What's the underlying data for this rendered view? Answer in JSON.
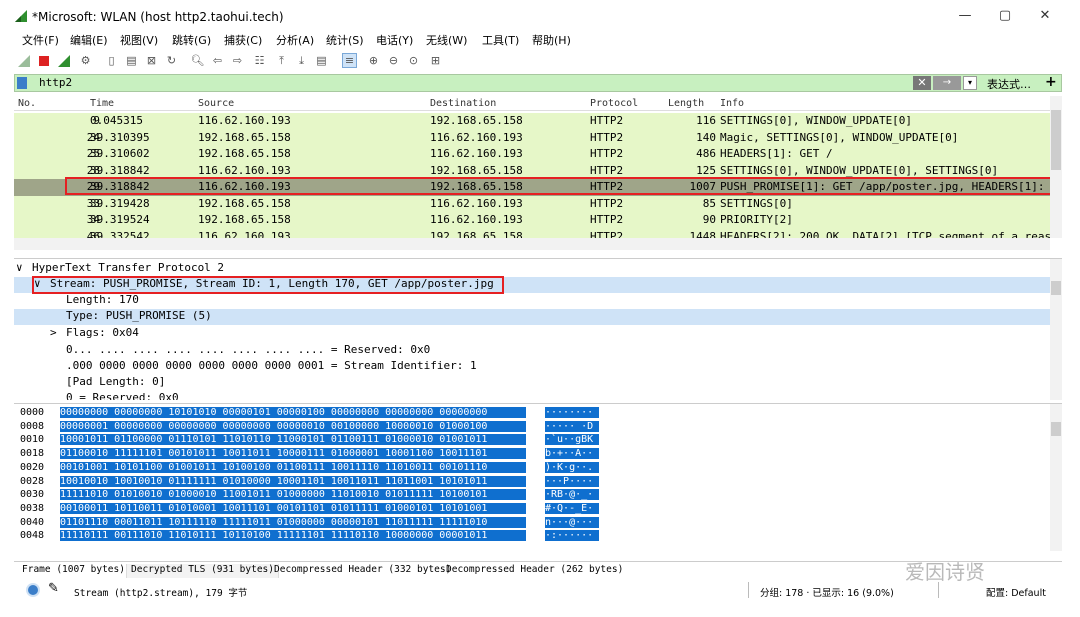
{
  "window": {
    "title": "*Microsoft: WLAN (host http2.taohui.tech)",
    "minimize": "—",
    "restore": "▢",
    "close": "✕"
  },
  "menu": [
    "文件(F)",
    "编辑(E)",
    "视图(V)",
    "跳转(G)",
    "捕获(C)",
    "分析(A)",
    "统计(S)",
    "电话(Y)",
    "无线(W)",
    "工具(T)",
    "帮助(H)"
  ],
  "filter": {
    "value": "http2",
    "clear": "✕",
    "apply": "→",
    "dropdown": "▾",
    "expressions": "表达式…",
    "add": "+"
  },
  "packet_list": {
    "columns": [
      "No.",
      "Time",
      "Source",
      "Destination",
      "Protocol",
      "Length",
      "Info"
    ],
    "rows": [
      {
        "no": "9",
        "time": "0.045315",
        "src": "116.62.160.193",
        "dst": "192.168.65.158",
        "proto": "HTTP2",
        "len": "116",
        "info": "SETTINGS[0], WINDOW_UPDATE[0]"
      },
      {
        "no": "24",
        "time": "39.310395",
        "src": "192.168.65.158",
        "dst": "116.62.160.193",
        "proto": "HTTP2",
        "len": "140",
        "info": "Magic, SETTINGS[0], WINDOW_UPDATE[0]"
      },
      {
        "no": "25",
        "time": "39.310602",
        "src": "192.168.65.158",
        "dst": "116.62.160.193",
        "proto": "HTTP2",
        "len": "486",
        "info": "HEADERS[1]: GET /"
      },
      {
        "no": "28",
        "time": "39.318842",
        "src": "116.62.160.193",
        "dst": "192.168.65.158",
        "proto": "HTTP2",
        "len": "125",
        "info": "SETTINGS[0], WINDOW_UPDATE[0], SETTINGS[0]"
      },
      {
        "no": "29",
        "time": "39.318842",
        "src": "116.62.160.193",
        "dst": "192.168.65.158",
        "proto": "HTTP2",
        "len": "1007",
        "info": "PUSH_PROMISE[1]: GET /app/poster.jpg, HEADERS[1]:"
      },
      {
        "no": "33",
        "time": "39.319428",
        "src": "192.168.65.158",
        "dst": "116.62.160.193",
        "proto": "HTTP2",
        "len": "85",
        "info": "SETTINGS[0]"
      },
      {
        "no": "34",
        "time": "39.319524",
        "src": "192.168.65.158",
        "dst": "116.62.160.193",
        "proto": "HTTP2",
        "len": "90",
        "info": "PRIORITY[2]"
      },
      {
        "no": "46",
        "time": "39.332542",
        "src": "116.62.160.193",
        "dst": "192.168.65.158",
        "proto": "HTTP2",
        "len": "1448",
        "info": "HEADERS[2]: 200 OK, DATA[2] [TCP segment of a reas"
      }
    ]
  },
  "details": [
    "HyperText Transfer Protocol 2",
    "Stream: PUSH_PROMISE, Stream ID: 1, Length 170, GET /app/poster.jpg",
    "Length: 170",
    "Type: PUSH_PROMISE (5)",
    "Flags: 0x04",
    "0... .... .... .... .... .... .... .... = Reserved: 0x0",
    ".000 0000 0000 0000 0000 0000 0000 0001 = Stream Identifier: 1",
    "[Pad Length: 0]",
    "0                                        = Reserved: 0x0"
  ],
  "tree_markers": {
    "expanded": "∨",
    "collapsed": ">"
  },
  "bytes": [
    {
      "off": "0000",
      "bin": "00000000 00000000 10101010 00000101 00000100 00000000 00000000 00000000",
      "asc": "········"
    },
    {
      "off": "0008",
      "bin": "00000001 00000000 00000000 00000000 00000010 00100000 10000010 01000100",
      "asc": "····· ·D"
    },
    {
      "off": "0010",
      "bin": "10001011 01100000 01110101 11010110 11000101 01100111 01000010 01001011",
      "asc": "·`u··gBK"
    },
    {
      "off": "0018",
      "bin": "01100010 11111101 00101011 10011011 10000111 01000001 10001100 10011101",
      "asc": "b·+··A··"
    },
    {
      "off": "0020",
      "bin": "00101001 10101100 01001011 10100100 01100111 10011110 11010011 00101110",
      "asc": ")·K·g··."
    },
    {
      "off": "0028",
      "bin": "10010010 10010010 01111111 01010000 10001101 10011011 11011001 10101011",
      "asc": "···P····"
    },
    {
      "off": "0030",
      "bin": "11111010 01010010 01000010 11001011 01000000 11010010 01011111 10100101",
      "asc": "·RB·@·_·"
    },
    {
      "off": "0038",
      "bin": "00100011 10110011 01010001 10011101 00101101 01011111 01000101 10101001",
      "asc": "#·Q·-_E·"
    },
    {
      "off": "0040",
      "bin": "01101110 00011011 10111110 11111011 01000000 00000101 11011111 11111010",
      "asc": "n···@···"
    },
    {
      "off": "0048",
      "bin": "11110111 00111010 11010111 10110100 11111101 11110110 10000000 00001011",
      "asc": "·:······"
    }
  ],
  "tabs": [
    "Frame (1007 bytes)",
    "Decrypted TLS (931 bytes)",
    "Decompressed Header (332 bytes)",
    "Decompressed Header (262 bytes)"
  ],
  "status": {
    "field": "Stream (http2.stream), 179 字节",
    "packets": "分组: 178 · 已显示: 16 (9.0%)",
    "profile": "配置: Default"
  },
  "watermark": "爱因诗贤",
  "colors": {
    "row_bg": "#e6f7c8",
    "selected_row": "#9fa589",
    "highlight": "#e52022",
    "bytes_sel": "#0f6fcf"
  }
}
